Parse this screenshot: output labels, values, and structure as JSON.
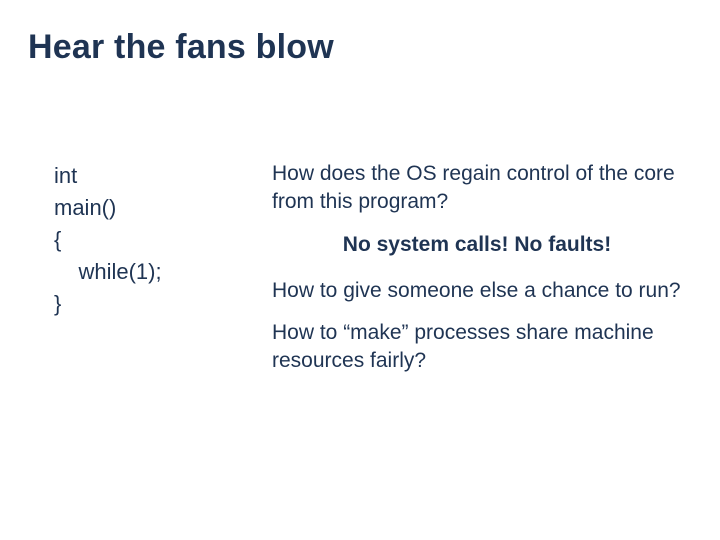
{
  "title": "Hear the fans blow",
  "code": {
    "l1": "int",
    "l2": "main()",
    "l3": "{",
    "l4": "    while(1);",
    "l5": "}"
  },
  "right": {
    "q1": "How does the OS regain control of the core from this program?",
    "callout": "No system calls!  No faults!",
    "q2": "How to give someone else a chance to run?",
    "q3": "How to “make” processes share machine resources fairly?"
  }
}
